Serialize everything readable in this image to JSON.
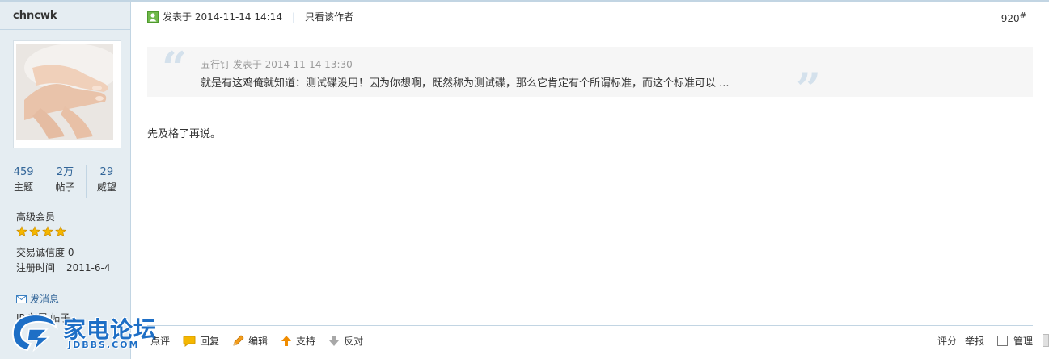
{
  "author": {
    "name": "chncwk",
    "stats": [
      {
        "value": "459",
        "label": "主题"
      },
      {
        "value": "2万",
        "label": "帖子"
      },
      {
        "value": "29",
        "label": "威望"
      }
    ],
    "member_level": "高级会员",
    "star_count": 4,
    "trade_credit": "交易诚信度 0",
    "register_label": "注册时间",
    "register_date": "2011-6-4",
    "pm_label": "发消息",
    "ip_line": "IP 归属 帖子"
  },
  "logo": {
    "text": "家电论坛",
    "sub": "JDBBS.COM"
  },
  "post": {
    "posted_at": "发表于 2014-11-14 14:14",
    "only_author": "只看该作者",
    "floor": "920",
    "floor_mark": "#",
    "quote": {
      "meta": "五行钉 发表于 2014-11-14 13:30",
      "text": "就是有这鸡俺就知道：测试碟没用！因为你想啊，既然称为测试碟，那么它肯定有个所谓标准，而这个标准可以 ..."
    },
    "body": "先及格了再说。"
  },
  "actions": {
    "comment": "点评",
    "reply": "回复",
    "edit": "编辑",
    "support": "支持",
    "oppose": "反对",
    "rate": "评分",
    "report": "举报",
    "manage": "管理"
  },
  "colors": {
    "sidebar_bg": "#e5edf2",
    "border": "#c2d5e3",
    "link": "#336699",
    "star": "#f5b700"
  }
}
